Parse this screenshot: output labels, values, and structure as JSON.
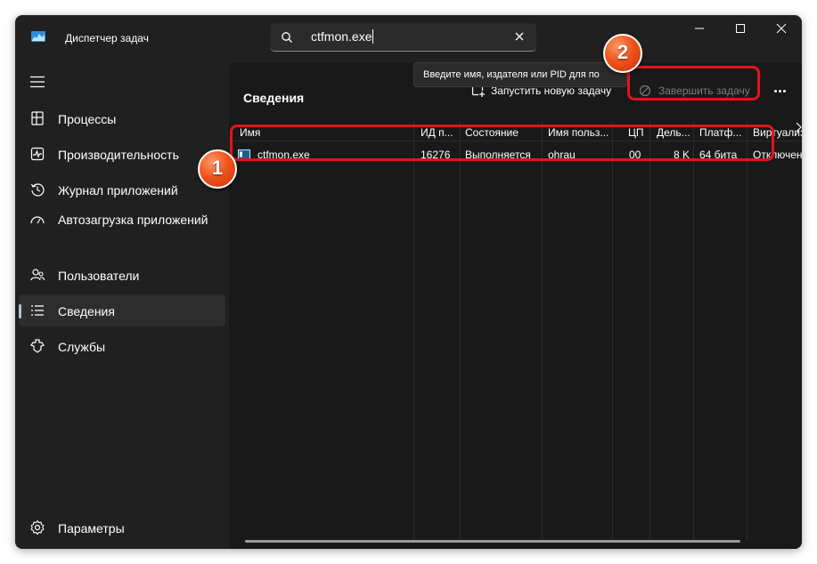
{
  "app": {
    "title": "Диспетчер задач"
  },
  "search": {
    "value": "ctfmon.exe"
  },
  "sidebar": {
    "items": [
      {
        "label": "Процессы",
        "icon": "processes-icon"
      },
      {
        "label": "Производительность",
        "icon": "performance-icon"
      },
      {
        "label": "Журнал приложений",
        "icon": "app-history-icon"
      },
      {
        "label": "Автозагрузка приложений",
        "icon": "startup-apps-icon"
      },
      {
        "label": "Пользователи",
        "icon": "users-icon"
      },
      {
        "label": "Сведения",
        "icon": "details-icon",
        "active": true
      },
      {
        "label": "Службы",
        "icon": "services-icon"
      }
    ],
    "settings": {
      "label": "Параметры",
      "icon": "settings-icon"
    }
  },
  "toolbar": {
    "title": "Сведения",
    "run_task": "Запустить новую задачу",
    "end_task": "Завершить задачу",
    "tooltip": "Введите имя, издателя или PID для по"
  },
  "table": {
    "columns": [
      "Имя",
      "ИД п...",
      "Состояние",
      "Имя польз...",
      "ЦП",
      "Дель...",
      "Платф...",
      "Виртуализ"
    ],
    "rows": [
      [
        "ctfmon.exe",
        "16276",
        "Выполняется",
        "ohrau",
        "00",
        "8 K",
        "64 бита",
        "Отключен"
      ]
    ]
  },
  "annotations": {
    "badge_1": "1",
    "badge_2": "2"
  },
  "colors": {
    "callout": "#e2141c",
    "badge": "#f0541c",
    "window_bg": "#202020",
    "content_bg": "#191919"
  }
}
